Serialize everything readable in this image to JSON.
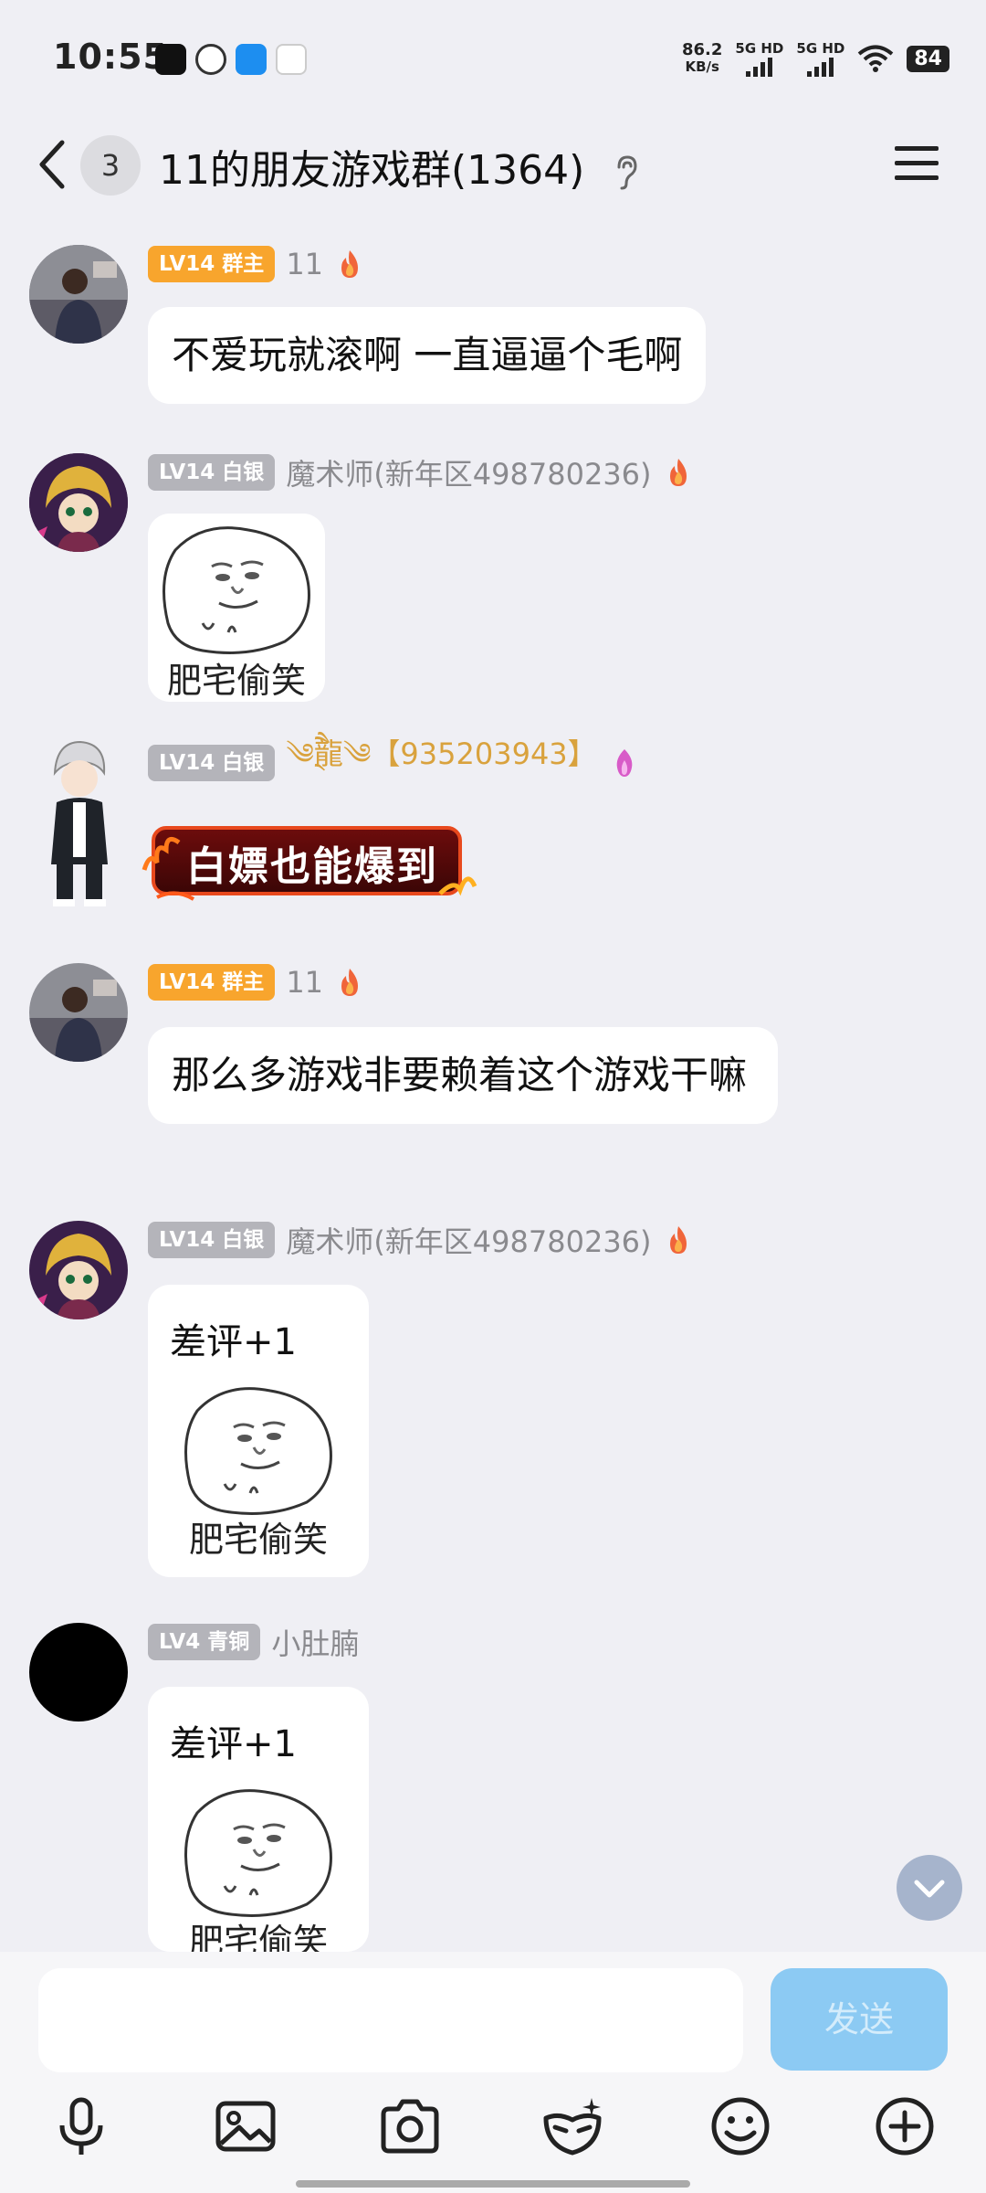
{
  "status_bar": {
    "time": "10:55",
    "net_speed_value": "86.2",
    "net_speed_unit": "KB/s",
    "sim1_label": "5G HD",
    "sim2_label": "5G HD",
    "battery": "84"
  },
  "header": {
    "unread_count": "3",
    "title": "11的朋友游戏群(1364)"
  },
  "messages": [
    {
      "badge": "LV14 群主",
      "sender": "11",
      "text": "不爱玩就滚啊 一直逼逼个毛啊"
    },
    {
      "badge": "LV14 白银",
      "sender": "魔术师(新年区498780236)",
      "sticker_caption": "肥宅偷笑"
    },
    {
      "badge": "LV14 白银",
      "sender": "༄྄ཻ龍༄【935203943】",
      "effect_text": "白嫖也能爆到"
    },
    {
      "badge": "LV14 群主",
      "sender": "11",
      "text": "那么多游戏非要赖着这个游戏干嘛"
    },
    {
      "badge": "LV14 白银",
      "sender": "魔术师(新年区498780236)",
      "caption": "差评+1",
      "sticker_caption": "肥宅偷笑"
    },
    {
      "badge": "LV4 青铜",
      "sender": "小肚腩",
      "caption": "差评+1",
      "sticker_caption": "肥宅偷笑"
    }
  ],
  "composer": {
    "input_value": "",
    "send_label": "发送"
  },
  "toolbar_icons": [
    "microphone-icon",
    "image-icon",
    "camera-icon",
    "face-mask-icon",
    "emoji-icon",
    "plus-icon"
  ],
  "colors": {
    "owner_badge": "#f8a52d",
    "silver_badge": "#b4b4ba",
    "send_button": "#8ccaf3",
    "background": "#efeff4"
  }
}
